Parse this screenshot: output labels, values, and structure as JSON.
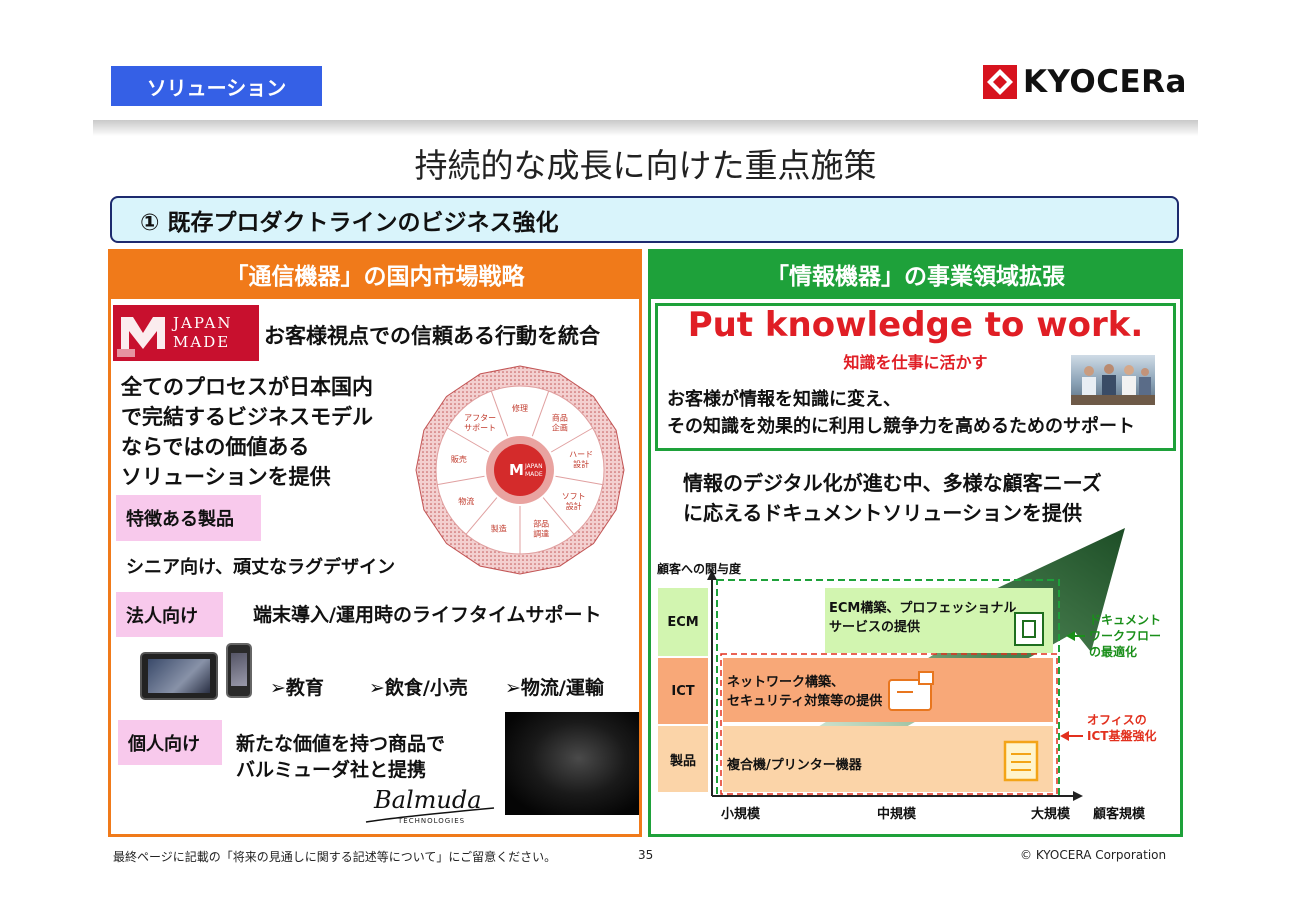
{
  "header": {
    "section_tag": "ソリューション",
    "logo_text": "KYOCERa",
    "title": "持続的な成長に向けた重点施策",
    "subhead": "① 既存プロダクトラインのビジネス強化"
  },
  "left": {
    "heading": "「通信機器」の国内市場戦略",
    "logo_words": [
      "JAPAN",
      "MADE"
    ],
    "logo_caption": "お客様視点での信頼ある行動を統合",
    "description": [
      "全てのプロセスが日本国内",
      "で完結するビジネスモデル",
      "ならではの価値ある",
      "ソリューションを提供"
    ],
    "cycle": {
      "center": [
        "JAPAN",
        "MADE"
      ],
      "segments": [
        "修理",
        "商品\n企画",
        "ハード\n設計",
        "ソフト\n設計",
        "部品\n調達",
        "製造",
        "物流",
        "販売",
        "アフター\nサポート"
      ]
    },
    "features_tag": "特徴ある製品",
    "features_text": "シニア向け、頑丈なラグデザイン",
    "corporate_tag": "法人向け",
    "corporate_text": "端末導入/運用時のライフタイムサポート",
    "markets": [
      "➢教育",
      "➢飲食/小売",
      "➢物流/運輸"
    ],
    "personal_tag": "個人向け",
    "personal_text": [
      "新たな価値を持つ商品で",
      "バルミューダ社と提携"
    ],
    "partner_logo": "Balmuda",
    "partner_sub": "TECHNOLOGIES"
  },
  "right": {
    "heading": "「情報機器」の事業領域拡張",
    "slogan": "Put knowledge to work.",
    "slogan_sub": "知識を仕事に活かす",
    "slogan_desc": [
      "お客様が情報を知識に変え、",
      "その知識を効果的に利用し競争力を高めるためのサポート"
    ],
    "description": [
      "情報のデジタル化が進む中、多様な顧客ニーズ",
      "に応えるドキュメントソリューションを提供"
    ],
    "matrix": {
      "y_axis_label": "顧客への関与度",
      "x_axis_label": "顧客規模",
      "rows": [
        "ECM",
        "ICT",
        "製品"
      ],
      "columns": [
        "小規模",
        "中規模",
        "大規模"
      ],
      "ecm_text": [
        "ECM構築、プロフェッショナル",
        "サービスの提供"
      ],
      "ict_text": [
        "ネットワーク構築、",
        "セキュリティ対策等の提供"
      ],
      "product_text": "複合機/プリンター機器",
      "green_note": [
        "ドキュメント",
        "ワークフロー",
        "の最適化"
      ],
      "red_note": [
        "オフィスの",
        "ICT基盤強化"
      ],
      "colors": {
        "green_dash": "#1ea13a",
        "red_dash": "#e2301e",
        "ecm_fill": "#d2f5b0",
        "ict_fill": "#f8a878",
        "product_fill": "#fbd4a8"
      }
    }
  },
  "footer": {
    "note": "最終ページに記載の「将来の見通しに関する記述等について」にご留意ください。",
    "page": "35",
    "copyright": "© KYOCERA Corporation"
  }
}
